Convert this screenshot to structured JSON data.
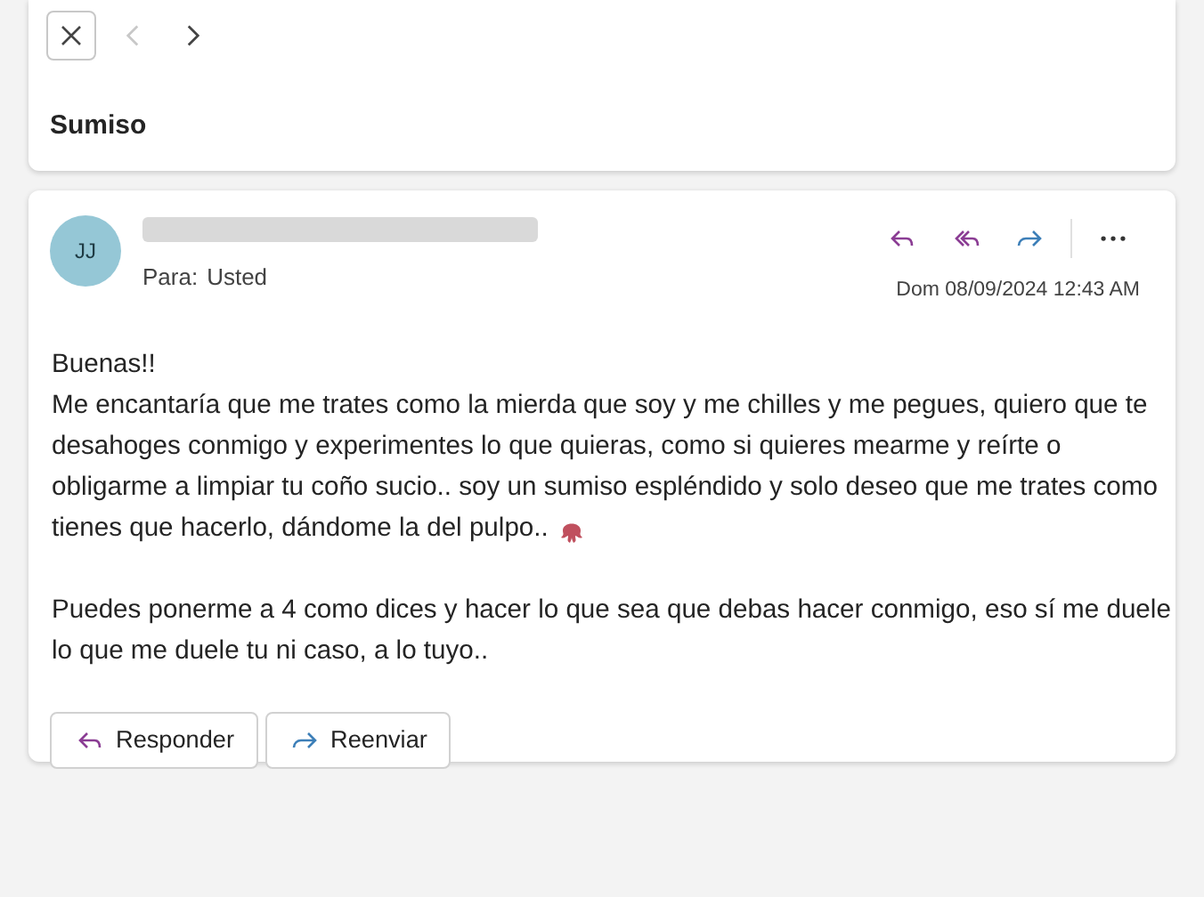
{
  "toolbar": {
    "nav": [
      {
        "kind": "close",
        "disabled": false
      },
      {
        "kind": "previous",
        "disabled": true
      },
      {
        "kind": "next",
        "disabled": false
      }
    ]
  },
  "subject": "Sumiso",
  "message": {
    "avatar_initials": "JJ",
    "to_label": "Para:",
    "to": "Usted",
    "date": "Dom 08/09/2024 12:43 AM",
    "actions": [
      {
        "kind": "reply"
      },
      {
        "kind": "reply_all"
      },
      {
        "kind": "forward"
      },
      {
        "kind": "more"
      }
    ],
    "body": [
      {
        "lines": [
          "Buenas!!",
          "Me encantaría que me trates como la mierda que soy y me chilles y me pegues, quiero que te",
          "desahoges conmigo y experimentes lo que quieras, como si quieres mearme y reírte o",
          "obligarme a limpiar tu coño sucio.. soy un sumiso espléndido y solo deseo que me trates como",
          "tienes que hacerlo, dándome la del pulpo.."
        ]
      },
      {
        "lines": [
          "Puedes ponerme a 4 como dices y hacer lo que sea que debas hacer conmigo, eso sí me duele",
          "lo que me duele tu ni caso, a lo tuyo.."
        ]
      }
    ],
    "buttons": [
      {
        "kind": "reply",
        "label": "Responder"
      },
      {
        "kind": "forward",
        "label": "Reenviar"
      }
    ]
  }
}
